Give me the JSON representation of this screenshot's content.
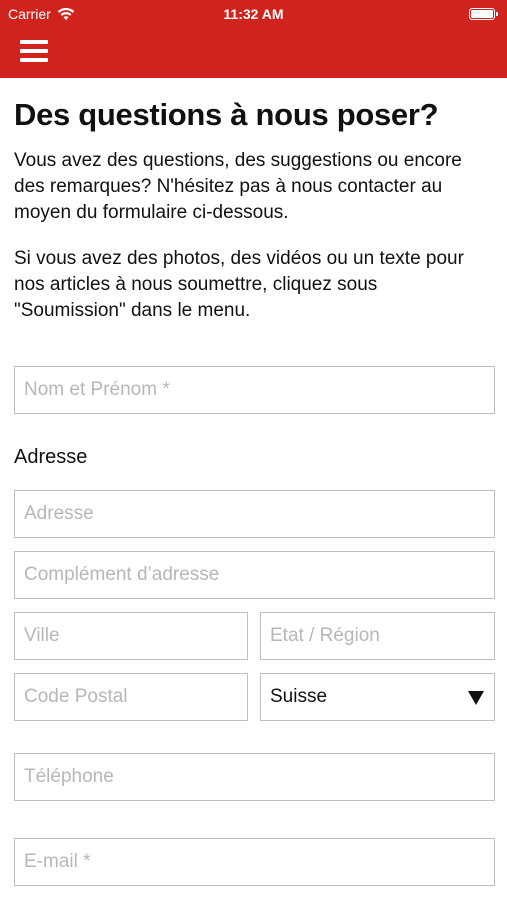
{
  "status_bar": {
    "carrier": "Carrier",
    "time": "11:32 AM"
  },
  "header": {
    "menu_icon": "hamburger-icon",
    "color": "#d0231e"
  },
  "page": {
    "title": "Des questions à nous poser?",
    "intro": "Vous avez des questions, des suggestions ou encore des remarques? N'hésitez pas à nous contacter au moyen du formulaire ci-dessous.",
    "intro2": "Si vous avez des photos, des vidéos ou un texte pour nos articles à nous soumettre, cliquez sous \"Soumission\" dans le menu."
  },
  "form": {
    "name_placeholder": "Nom et Prénom *",
    "address_section_label": "Adresse",
    "address_placeholder": "Adresse",
    "address2_placeholder": "Complément d’adresse",
    "city_placeholder": "Ville",
    "state_placeholder": "Etat / Région",
    "postal_placeholder": "Code Postal",
    "country_value": "Suisse",
    "phone_placeholder": "Téléphone",
    "email_placeholder": "E-mail *"
  }
}
